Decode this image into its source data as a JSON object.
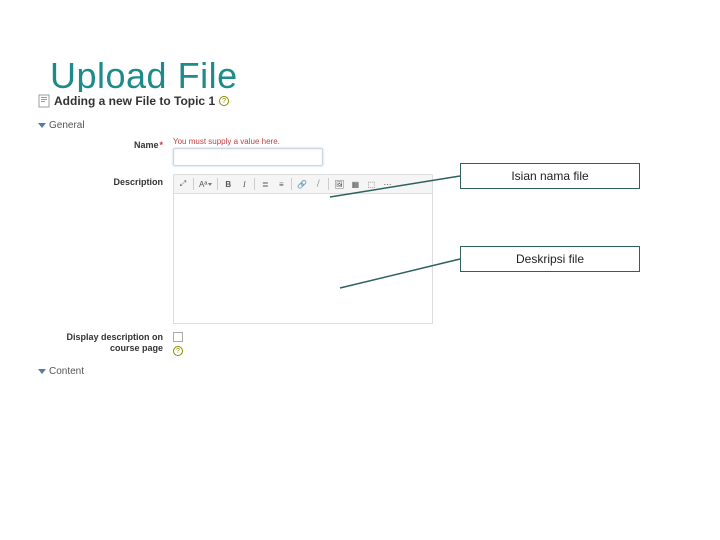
{
  "slide": {
    "title": "Upload File"
  },
  "form": {
    "header_title": "Adding a new File to Topic 1",
    "sections": {
      "general": "General",
      "content": "Content"
    },
    "fields": {
      "name_label": "Name",
      "name_validation": "You must supply a value here.",
      "description_label": "Description",
      "display_on_course_label": "Display description on course page"
    },
    "toolbar": {
      "expand": "⤢",
      "para": "Aª",
      "bold": "B",
      "italic": "I",
      "bullets": "≣",
      "numbers": "≡",
      "link": "🔗",
      "unlink": "⧸",
      "image": "🖼",
      "media": "▦",
      "subscript": "⬚",
      "more": "⋯"
    }
  },
  "annotations": {
    "name": "Isian nama file",
    "description": "Deskripsi file"
  }
}
